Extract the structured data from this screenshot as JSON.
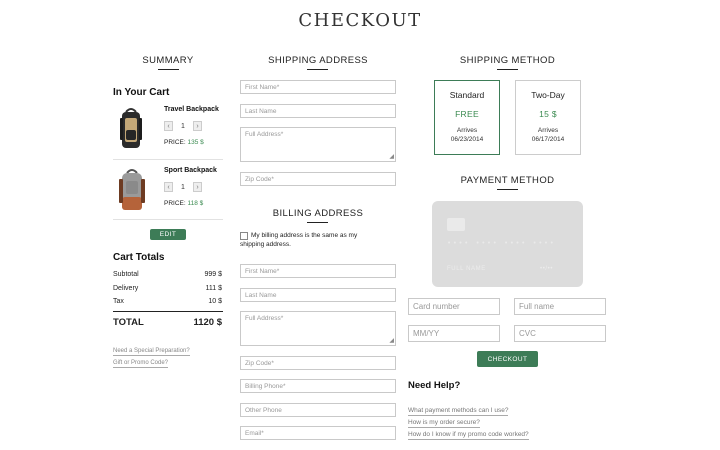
{
  "page_title": "CHECKOUT",
  "summary": {
    "heading": "SUMMARY",
    "in_cart_label": "In Your Cart",
    "items": [
      {
        "name": "Travel Backpack",
        "qty": "1",
        "price_label": "PRICE:",
        "price": "135 $",
        "dec": "‹",
        "inc": "›"
      },
      {
        "name": "Sport Backpack",
        "qty": "1",
        "price_label": "PRICE:",
        "price": "118 $",
        "dec": "‹",
        "inc": "›"
      }
    ],
    "edit_label": "EDIT",
    "totals_heading": "Cart Totals",
    "subtotal_label": "Subtotal",
    "subtotal": "999 $",
    "delivery_label": "Delivery",
    "delivery": "111 $",
    "tax_label": "Tax",
    "tax": "10 $",
    "total_label": "TOTAL",
    "total": "1120 $",
    "special_link": "Need a Special Preparation?",
    "promo_link": "Gift or Promo Code?"
  },
  "shipping_address": {
    "heading": "SHIPPING ADDRESS",
    "first_name": "First Name*",
    "last_name": "Last Name",
    "full_address": "Full Address*",
    "zip": "Zip Code*"
  },
  "billing_address": {
    "heading": "BILLING ADDRESS",
    "same_label": "My billing address is the same as my shipping address.",
    "first_name": "First Name*",
    "last_name": "Last Name",
    "full_address": "Full Address*",
    "zip": "Zip Code*",
    "phone": "Billing Phone*",
    "other_phone": "Other Phone",
    "email": "Email*"
  },
  "shipping_method": {
    "heading": "SHIPPING METHOD",
    "options": [
      {
        "name": "Standard",
        "price": "FREE",
        "arrives": "Arrives",
        "date": "06/23/2014",
        "selected": true
      },
      {
        "name": "Two-Day",
        "price": "15 $",
        "arrives": "Arrives",
        "date": "06/17/2014",
        "selected": false
      }
    ]
  },
  "payment_method": {
    "heading": "PAYMENT METHOD",
    "card_mask": "•••• •••• •••• ••••",
    "card_name": "FULL NAME",
    "card_exp": "••/••",
    "card_number": "Card number",
    "full_name": "Full name",
    "mmyy": "MM/YY",
    "cvc": "CVC",
    "checkout_label": "CHECKOUT"
  },
  "help": {
    "heading": "Need Help?",
    "links": [
      "What payment methods can I use?",
      "How is my order secure?",
      "How do I know if my promo code worked?"
    ]
  },
  "colors": {
    "accent": "#3d7c57",
    "price_green": "#3a8a50"
  }
}
